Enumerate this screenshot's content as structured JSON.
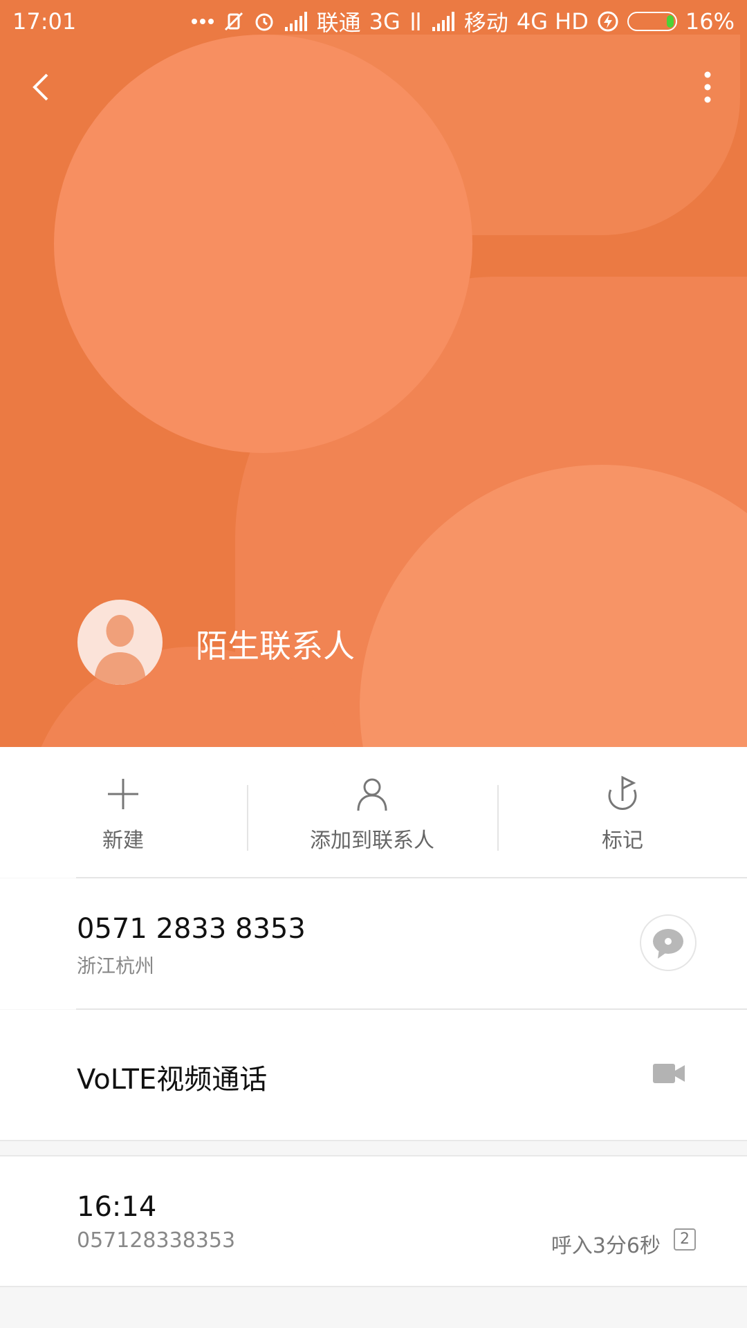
{
  "status_bar": {
    "time": "17:01",
    "carrier1": "联通",
    "network1": "3G",
    "carrier2": "移动",
    "network2": "4G HD",
    "battery_percent": "16%",
    "battery_level": 0.16,
    "icons": [
      "more-icon",
      "mute-vibrate-icon",
      "alarm-icon",
      "signal-icon",
      "data-arrows-icon",
      "signal-icon",
      "charging-icon",
      "battery-icon"
    ]
  },
  "nav": {
    "back_icon": "back-icon",
    "more_icon": "more-vert-icon"
  },
  "contact": {
    "name": "陌生联系人",
    "avatar_icon": "person-avatar-icon"
  },
  "actions": [
    {
      "label": "新建",
      "icon": "plus-icon"
    },
    {
      "label": "添加到联系人",
      "icon": "person-add-icon"
    },
    {
      "label": "标记",
      "icon": "flag-icon"
    }
  ],
  "phone": {
    "number": "0571 2833 8353",
    "location": "浙江杭州",
    "message_icon": "message-icon"
  },
  "video_call": {
    "label": "VoLTE视频通话",
    "icon": "video-camera-icon"
  },
  "call_log": {
    "time": "16:14",
    "number": "057128338353",
    "duration": "呼入3分6秒",
    "sim": "2"
  },
  "colors": {
    "header_bg": "#eb7a43",
    "accent_light": "#f78f61",
    "battery_fill": "#4cd137"
  }
}
